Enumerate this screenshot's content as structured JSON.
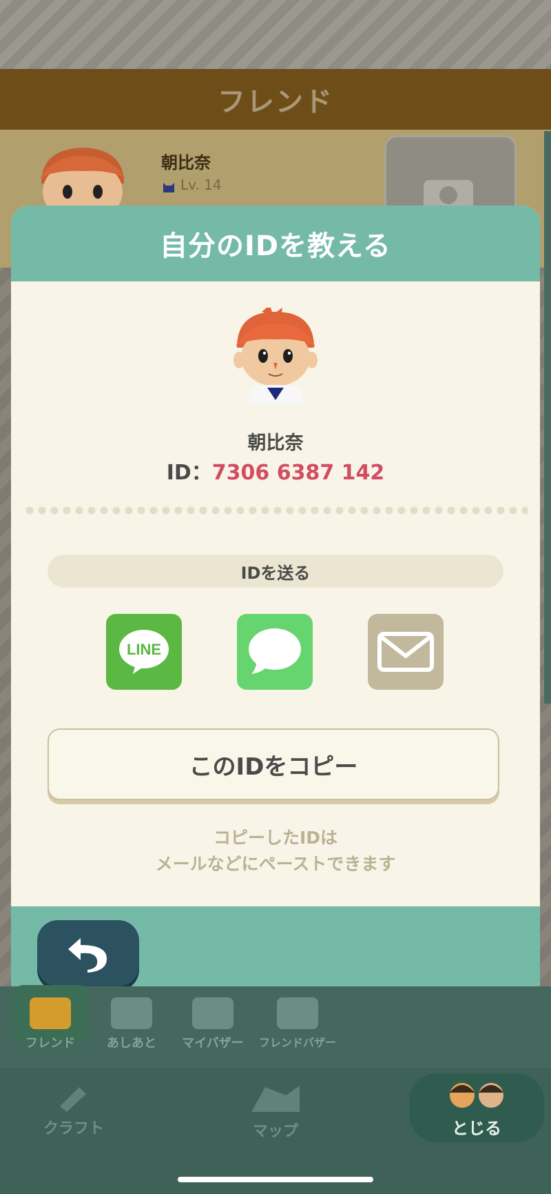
{
  "header": {
    "title": "フレンド"
  },
  "friend": {
    "name": "朝比奈",
    "level": "Lv. 14"
  },
  "modal": {
    "title": "自分のIDを教える",
    "name": "朝比奈",
    "id_prefix": "ID：",
    "id_value": "7306 6387 142",
    "send_label": "IDを送る",
    "share_icons": [
      "line-icon",
      "messages-icon",
      "mail-icon"
    ],
    "line_text": "LINE",
    "copy_label": "このIDをコピー",
    "hint_line1": "コピーしたIDは",
    "hint_line2": "メールなどにペーストできます"
  },
  "nav_sub": [
    "フレンド",
    "あしあと",
    "マイバザー",
    "フレンドバザー"
  ],
  "nav_main": {
    "craft": "クラフト",
    "map": "マップ",
    "close": "とじる"
  },
  "colors": {
    "teal": "#74baa7",
    "id_red": "#d24c62",
    "line_green": "#5ab843",
    "message_green": "#66d46f",
    "mail_tan": "#c2b89c"
  }
}
